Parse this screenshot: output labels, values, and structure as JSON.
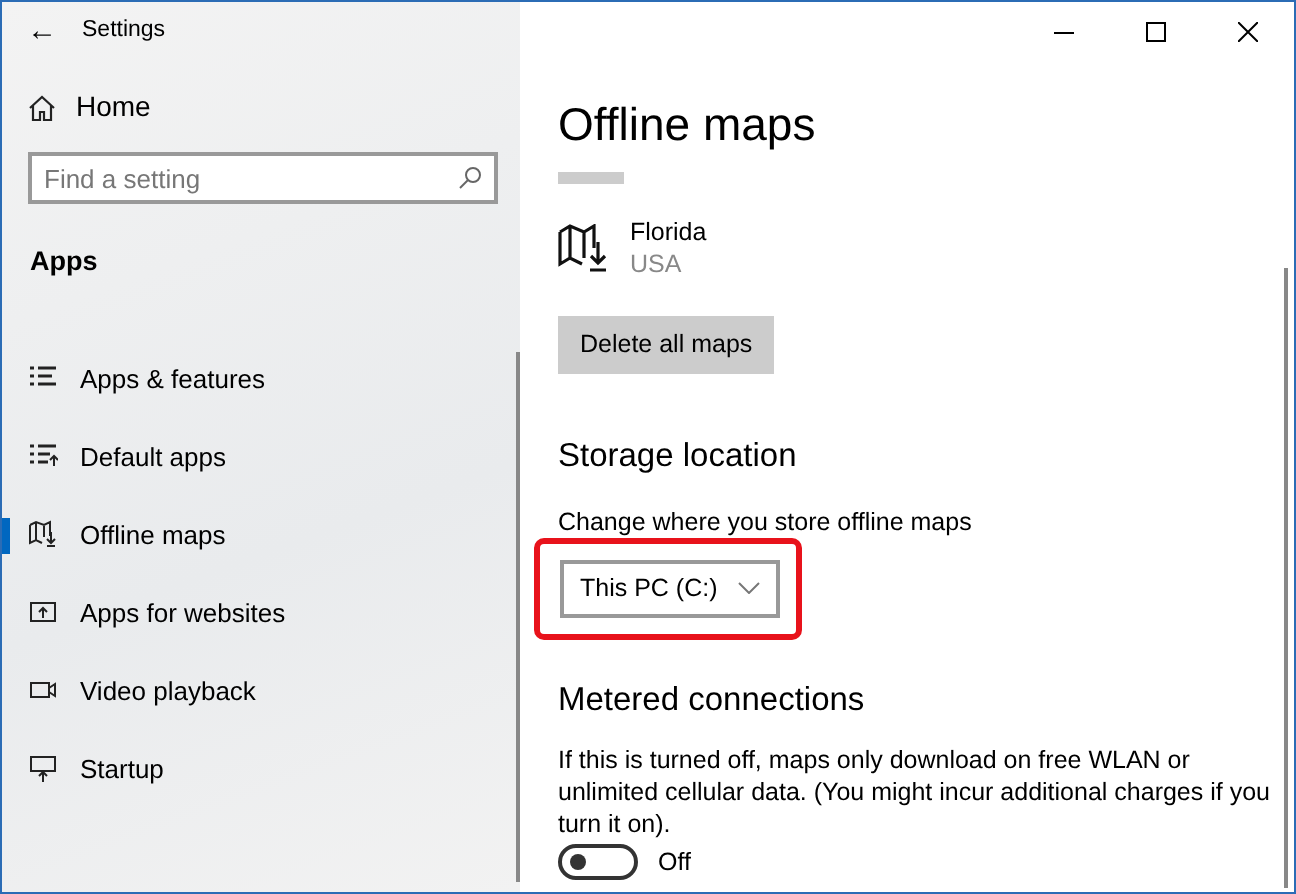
{
  "window": {
    "title": "Settings",
    "back": "←"
  },
  "sidebar": {
    "home": "Home",
    "search": {
      "placeholder": "Find a setting"
    },
    "section": "Apps",
    "items": [
      {
        "label": "Apps & features",
        "selected": false
      },
      {
        "label": "Default apps",
        "selected": false
      },
      {
        "label": "Offline maps",
        "selected": true
      },
      {
        "label": "Apps for websites",
        "selected": false
      },
      {
        "label": "Video playback",
        "selected": false
      },
      {
        "label": "Startup",
        "selected": false
      }
    ]
  },
  "page": {
    "title": "Offline maps",
    "maps": [
      {
        "name": "Florida",
        "region": "USA"
      }
    ],
    "delete_button": "Delete all maps",
    "storage": {
      "heading": "Storage location",
      "label": "Change where you store offline maps",
      "dropdown": {
        "value": "This PC (C:)",
        "highlighted": true
      }
    },
    "metered": {
      "heading": "Metered connections",
      "description": "If this is turned off, maps only download on free WLAN or unlimited cellular data. (You might incur additional charges if you turn it on).",
      "toggle": {
        "on": false,
        "state_label": "Off"
      }
    }
  }
}
